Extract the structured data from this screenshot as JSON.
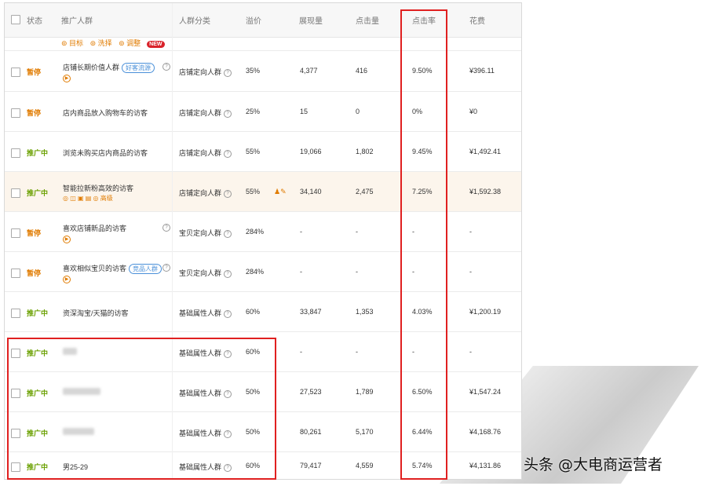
{
  "header": {
    "status": "状态",
    "crowd": "推广人群",
    "category": "人群分类",
    "premium": "溢价",
    "impressions": "展现量",
    "clicks": "点击量",
    "ctr": "点击率",
    "cost": "花费"
  },
  "legend": {
    "target": "⊚ 目标",
    "select": "⊚ 洗择",
    "adjust": "⊚ 调整",
    "new_badge": "NEW"
  },
  "rows": [
    {
      "status": "暂停",
      "status_type": "pause",
      "name": "店铺长期价值人群",
      "tag": "好客流源",
      "category": "店铺定向人群",
      "premium": "35%",
      "impressions": "4,377",
      "clicks": "416",
      "ctr": "9.50%",
      "cost": "¥396.11"
    },
    {
      "status": "暂停",
      "status_type": "pause",
      "name": "店内商品放入购物车的访客",
      "category": "店铺定向人群",
      "premium": "25%",
      "impressions": "15",
      "clicks": "0",
      "ctr": "0%",
      "cost": "¥0"
    },
    {
      "status": "推广中",
      "status_type": "run",
      "name": "浏览未购买店内商品的访客",
      "category": "店铺定向人群",
      "premium": "55%",
      "impressions": "19,066",
      "clicks": "1,802",
      "ctr": "9.45%",
      "cost": "¥1,492.41"
    },
    {
      "status": "推广中",
      "status_type": "run",
      "name": "智能拉新粉高效的访客",
      "sub_action": "高级",
      "category": "店铺定向人群",
      "premium": "55%",
      "impressions": "34,140",
      "clicks": "2,475",
      "ctr": "7.25%",
      "cost": "¥1,592.38"
    },
    {
      "status": "暂停",
      "status_type": "pause",
      "name": "喜欢店铺新品的访客",
      "category": "宝贝定向人群",
      "premium": "284%",
      "impressions": "-",
      "clicks": "-",
      "ctr": "-",
      "cost": "-"
    },
    {
      "status": "暂停",
      "status_type": "pause",
      "name": "喜欢相似宝贝的访客",
      "tag": "竞品人群",
      "category": "宝贝定向人群",
      "premium": "284%",
      "impressions": "-",
      "clicks": "-",
      "ctr": "-",
      "cost": "-"
    },
    {
      "status": "推广中",
      "status_type": "run",
      "name": "资深淘宝/天猫的访客",
      "category": "基础属性人群",
      "premium": "60%",
      "impressions": "33,847",
      "clicks": "1,353",
      "ctr": "4.03%",
      "cost": "¥1,200.19"
    },
    {
      "status": "推广中",
      "status_type": "run",
      "name": "",
      "category": "基础属性人群",
      "premium": "60%",
      "impressions": "-",
      "clicks": "-",
      "ctr": "-",
      "cost": "-"
    },
    {
      "status": "推广中",
      "status_type": "run",
      "name": "",
      "category": "基础属性人群",
      "premium": "50%",
      "impressions": "27,523",
      "clicks": "1,789",
      "ctr": "6.50%",
      "cost": "¥1,547.24"
    },
    {
      "status": "推广中",
      "status_type": "run",
      "name": "",
      "category": "基础属性人群",
      "premium": "50%",
      "impressions": "80,261",
      "clicks": "5,170",
      "ctr": "6.44%",
      "cost": "¥4,168.76"
    },
    {
      "status": "推广中",
      "status_type": "run",
      "name": "男25-29",
      "category": "基础属性人群",
      "premium": "60%",
      "impressions": "79,417",
      "clicks": "4,559",
      "ctr": "5.74%",
      "cost": "¥4,131.86"
    }
  ],
  "watermark": "头条 @大电商运营者",
  "colors": {
    "highlight_box": "#e02020",
    "paused": "#e07b00",
    "running": "#6aa000",
    "row_highlight": "#fcf5ec"
  }
}
